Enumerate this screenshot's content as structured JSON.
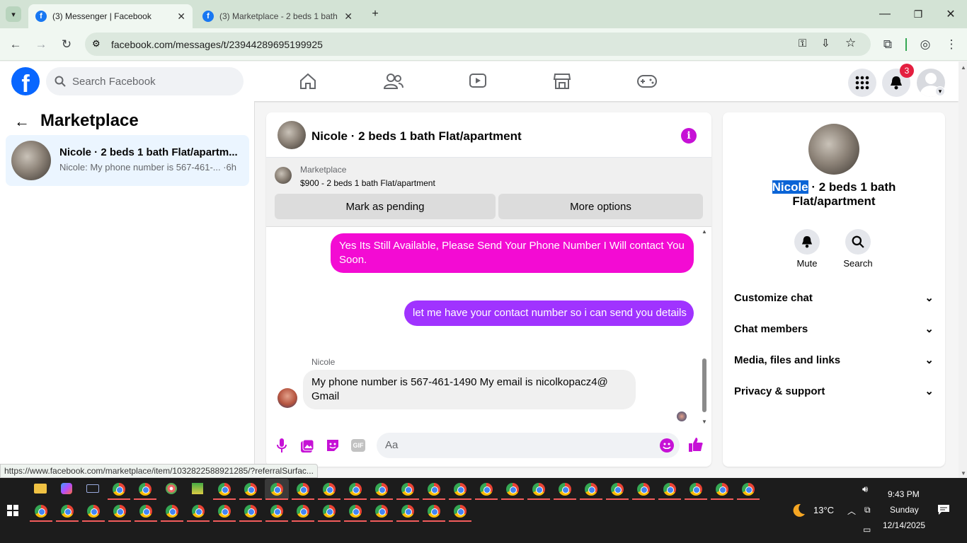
{
  "browser": {
    "tabs": [
      {
        "title": "(3) Messenger | Facebook",
        "favicon": "facebook-icon"
      },
      {
        "title": "(3) Marketplace - 2 beds 1 bath",
        "favicon": "facebook-icon"
      }
    ],
    "url": "facebook.com/messages/t/23944289695199925",
    "status_url": "https://www.facebook.com/marketplace/item/1032822588921285/?referralSurfac..."
  },
  "facebook": {
    "search_placeholder": "Search Facebook",
    "notification_count": "3",
    "brand_color": "#0866ff"
  },
  "sidebar": {
    "title": "Marketplace",
    "conversation": {
      "name": "Nicole · 2 beds 1 bath Flat/apartm...",
      "preview": "Nicole: My phone number is 567-461-... ·6h"
    }
  },
  "chat": {
    "title": "Nicole · 2 beds 1 bath Flat/apartment",
    "marketplace_label": "Marketplace",
    "listing": "$900 - 2 beds 1 bath Flat/apartment",
    "mark_pending": "Mark as pending",
    "more_options": "More options",
    "messages": [
      {
        "from": "me",
        "text": "Yes Its Still Available, Please Send Your Phone Number I Will contact You Soon.",
        "color": "#f30bd3"
      },
      {
        "from": "me",
        "text": "let me have your contact number so i can send you details",
        "color": "#a033ff"
      },
      {
        "from": "Nicole",
        "sender_label": "Nicole",
        "text": "My phone number is 567-461-1490 My email is nicolkopacz4@ Gmail"
      }
    ],
    "composer_placeholder": "Aa",
    "accent": "#c611d6"
  },
  "info": {
    "name_highlight": "Nicole",
    "name_rest": " · 2 beds 1 bath",
    "name_line2": "Flat/apartment",
    "mute": "Mute",
    "search": "Search",
    "sections": [
      "Customize chat",
      "Chat members",
      "Media, files and links",
      "Privacy & support"
    ]
  },
  "taskbar": {
    "time": "9:43 PM",
    "day": "Sunday",
    "date": "12/14/2025",
    "weather": "13°C"
  }
}
